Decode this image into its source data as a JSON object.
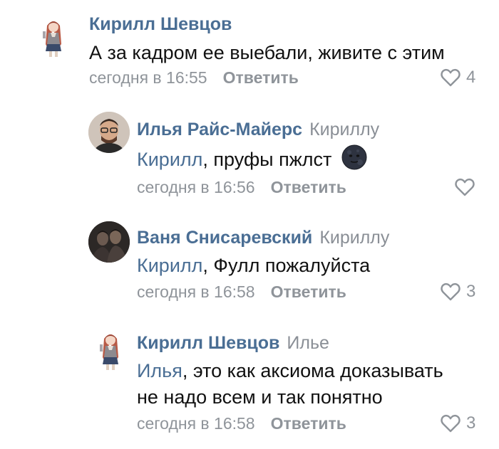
{
  "comments": [
    {
      "author": "Кирилл Шевцов",
      "reply_to": "",
      "mention": "",
      "text": "А за кадром ее выебали, живите с этим",
      "text_line2": "",
      "time": "сегодня в 16:55",
      "reply_label": "Ответить",
      "likes": "4",
      "avatar_icon": "anime-girl-avatar-icon"
    },
    {
      "author": "Илья Райс-Майерс",
      "reply_to": "Кириллу",
      "mention": "Кирилл",
      "text": ", пруфы пжлст",
      "text_line2": "",
      "emoji": "new-moon-face-emoji",
      "time": "сегодня в 16:56",
      "reply_label": "Ответить",
      "likes": "",
      "avatar_icon": "man-photo-avatar-icon"
    },
    {
      "author": "Ваня Снисаревский",
      "reply_to": "Кириллу",
      "mention": "Кирилл",
      "text": ", Фулл пожалуйста",
      "text_line2": "",
      "time": "сегодня в 16:58",
      "reply_label": "Ответить",
      "likes": "3",
      "avatar_icon": "group-photo-avatar-icon"
    },
    {
      "author": "Кирилл Шевцов",
      "reply_to": "Илье",
      "mention": "Илья",
      "text": ", это как аксиома доказывать",
      "text_line2": "не надо всем и так понятно",
      "time": "сегодня в 16:58",
      "reply_label": "Ответить",
      "likes": "3",
      "avatar_icon": "anime-girl-avatar-icon"
    }
  ],
  "colors": {
    "name": "#4a6e94",
    "meta": "#8f949a",
    "text": "#111111"
  }
}
